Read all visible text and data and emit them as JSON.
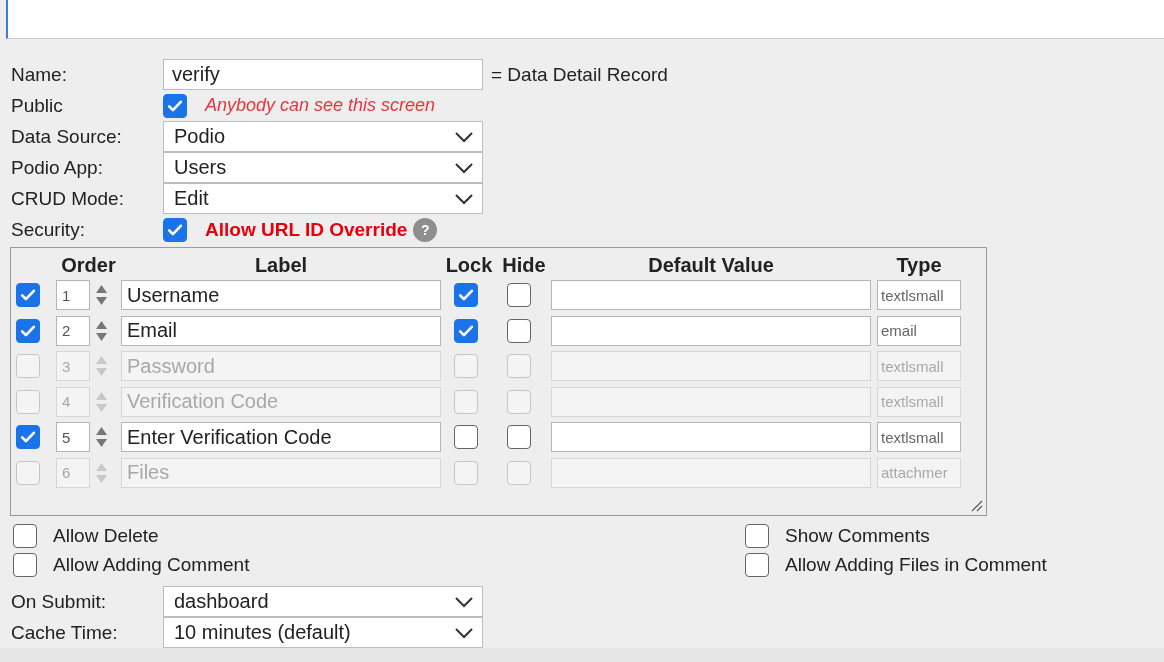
{
  "name": {
    "label": "Name:",
    "value": "verify",
    "note": "= Data Detail Record"
  },
  "public": {
    "label": "Public",
    "checked": true,
    "note": "Anybody can see this screen"
  },
  "selects": [
    {
      "label": "Data Source:",
      "value": "Podio"
    },
    {
      "label": "Podio App:",
      "value": "Users"
    },
    {
      "label": "CRUD Mode:",
      "value": "Edit"
    }
  ],
  "security": {
    "label": "Security:",
    "checked": true,
    "note": "Allow URL ID Override",
    "help": "?"
  },
  "table": {
    "columns": [
      "Order",
      "Label",
      "Lock",
      "Hide",
      "Default Value",
      "Type"
    ],
    "rows": [
      {
        "checked": true,
        "disabled": false,
        "order": "1",
        "label": "Username",
        "lock": true,
        "hide": false,
        "type": "textlsmall"
      },
      {
        "checked": true,
        "disabled": false,
        "order": "2",
        "label": "Email",
        "lock": true,
        "hide": false,
        "type": "email"
      },
      {
        "checked": false,
        "disabled": true,
        "order": "3",
        "label": "Password",
        "lock": false,
        "hide": false,
        "type": "textlsmall"
      },
      {
        "checked": false,
        "disabled": true,
        "order": "4",
        "label": "Verification Code",
        "lock": false,
        "hide": false,
        "type": "textlsmall"
      },
      {
        "checked": true,
        "disabled": false,
        "order": "5",
        "label": "Enter Verification Code",
        "lock": false,
        "hide": false,
        "type": "textlsmall"
      },
      {
        "checked": false,
        "disabled": true,
        "order": "6",
        "label": "Files",
        "lock": false,
        "hide": false,
        "type": "attachmer"
      }
    ]
  },
  "options_left": [
    {
      "label": "Allow Delete",
      "checked": false
    },
    {
      "label": "Allow Adding Comment",
      "checked": false
    }
  ],
  "options_right": [
    {
      "label": "Show Comments",
      "checked": false
    },
    {
      "label": "Allow Adding Files in Comment",
      "checked": false
    }
  ],
  "bottom_selects": [
    {
      "label": "On Submit:",
      "value": "dashboard"
    },
    {
      "label": "Cache Time:",
      "value": "10 minutes (default)"
    }
  ]
}
